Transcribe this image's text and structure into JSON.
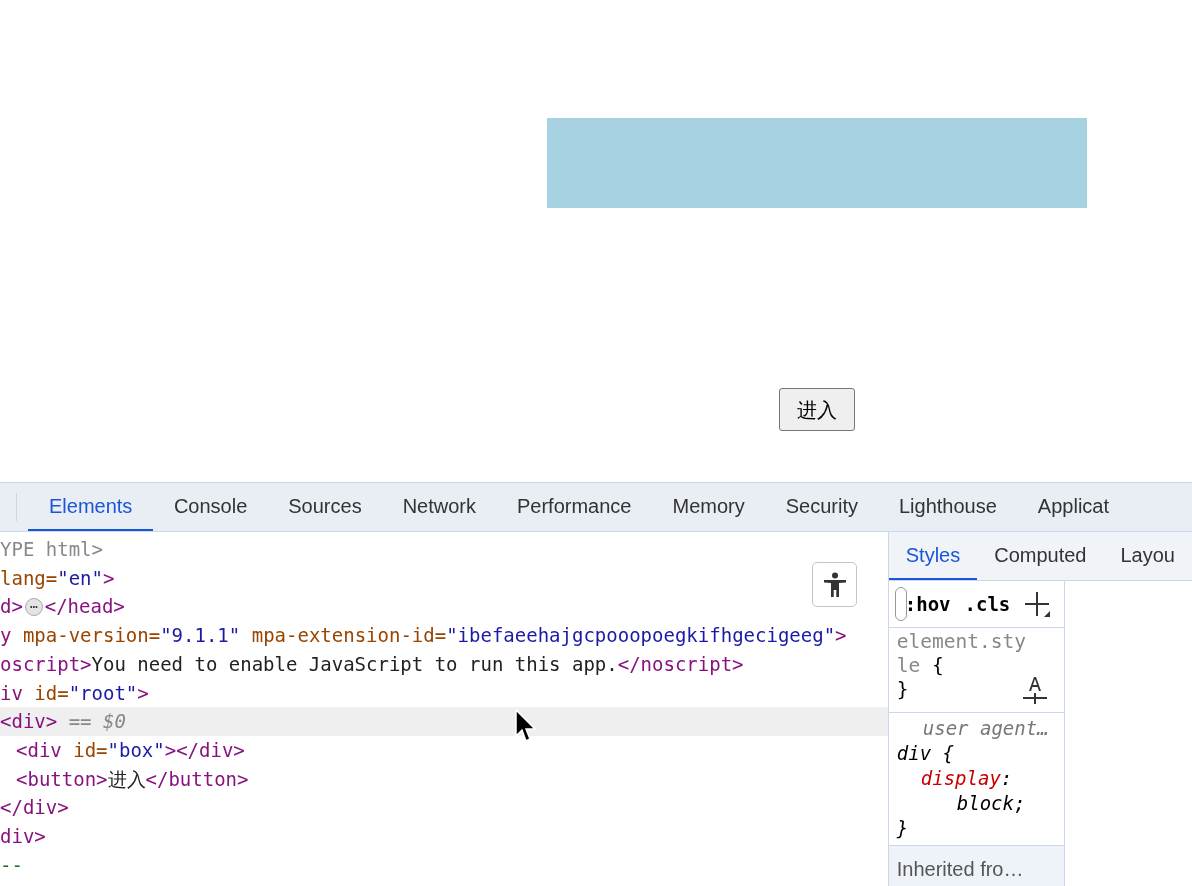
{
  "page": {
    "button": "进入"
  },
  "devtools": {
    "tabs": [
      {
        "label": "Elements",
        "selected": true
      },
      {
        "label": "Console",
        "selected": false
      },
      {
        "label": "Sources",
        "selected": false
      },
      {
        "label": "Network",
        "selected": false
      },
      {
        "label": "Performance",
        "selected": false
      },
      {
        "label": "Memory",
        "selected": false
      },
      {
        "label": "Security",
        "selected": false
      },
      {
        "label": "Lighthouse",
        "selected": false
      },
      {
        "label": "Applicat",
        "selected": false
      }
    ],
    "lines": [
      {
        "selected": false,
        "tokens": [
          {
            "kind": "doctype",
            "text": "YPE html>"
          }
        ]
      },
      {
        "selected": false,
        "tokens": [
          {
            "kind": "attr",
            "text": "lang="
          },
          {
            "kind": "value",
            "text": "\"en\""
          },
          {
            "kind": "tag",
            "text": ">"
          }
        ]
      },
      {
        "selected": false,
        "tokens": [
          {
            "kind": "tag",
            "text": "d>"
          },
          {
            "kind": "badge",
            "text": "⋯"
          },
          {
            "kind": "tag",
            "text": "</head>"
          }
        ]
      },
      {
        "selected": false,
        "tokens": [
          {
            "kind": "tag",
            "text": "y"
          },
          {
            "kind": "attr",
            "text": " mpa-version="
          },
          {
            "kind": "value",
            "text": "\"9.1.1\""
          },
          {
            "kind": "attr",
            "text": " mpa-extension-id="
          },
          {
            "kind": "value",
            "text": "\"ibefaeehajgcpooopoegkifhgecigeeg\""
          },
          {
            "kind": "tag",
            "text": ">"
          }
        ]
      },
      {
        "selected": false,
        "tokens": [
          {
            "kind": "tag",
            "text": "oscript>"
          },
          {
            "kind": "text",
            "text": "You need to enable JavaScript to run this app."
          },
          {
            "kind": "tag",
            "text": "</noscript>"
          }
        ]
      },
      {
        "selected": false,
        "tokens": [
          {
            "kind": "tag",
            "text": "iv"
          },
          {
            "kind": "attr",
            "text": " id="
          },
          {
            "kind": "value",
            "text": "\"root\""
          },
          {
            "kind": "tag",
            "text": ">"
          }
        ]
      },
      {
        "selected": true,
        "tokens": [
          {
            "kind": "tag",
            "text": "<div>"
          },
          {
            "kind": "doctype",
            "text": " == "
          },
          {
            "kind": "ref",
            "text": "$0"
          }
        ],
        "children": [
          {
            "selected": false,
            "tokens": [
              {
                "kind": "tag",
                "text": "<div"
              },
              {
                "kind": "attr",
                "text": " id="
              },
              {
                "kind": "value",
                "text": "\"box\""
              },
              {
                "kind": "tag",
                "text": "></div>"
              }
            ]
          },
          {
            "selected": false,
            "tokens": [
              {
                "kind": "tag",
                "text": "<button>"
              },
              {
                "kind": "text",
                "text": "进入"
              },
              {
                "kind": "tag",
                "text": "</button>"
              }
            ]
          }
        ]
      },
      {
        "selected": false,
        "tokens": [
          {
            "kind": "tag",
            "text": "</div>"
          }
        ]
      },
      {
        "selected": false,
        "tokens": [
          {
            "kind": "tag",
            "text": "div>"
          }
        ]
      },
      {
        "selected": false,
        "tokens": [
          {
            "kind": "comment",
            "text": "--"
          }
        ]
      }
    ],
    "side_tabs": [
      {
        "label": "Styles",
        "selected": true
      },
      {
        "label": "Computed",
        "selected": false
      },
      {
        "label": "Layou",
        "selected": false
      }
    ],
    "toolbar": {
      "hov": ":hov",
      "cls": ".cls"
    },
    "element_style": {
      "selector": "element.style",
      "open": " {",
      "close": "}"
    },
    "user_agent_rule": {
      "origin": "user agent…",
      "selector": "div",
      "open": " {",
      "declarations": [
        {
          "name": "display",
          "colon": ":",
          "value": "block;"
        }
      ],
      "close": "}"
    },
    "inherited": "Inherited fro…"
  }
}
